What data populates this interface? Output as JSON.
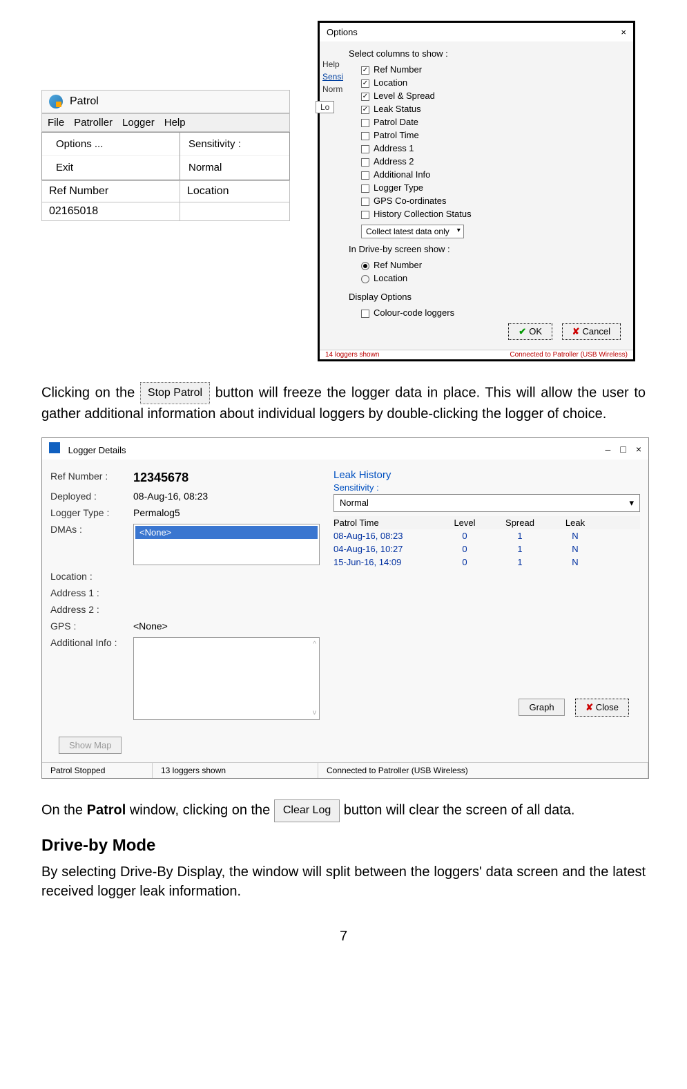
{
  "menu_panel": {
    "title": "Patrol",
    "menubar": [
      "File",
      "Patroller",
      "Logger",
      "Help"
    ],
    "open_items_left": [
      "Options ...",
      "Exit"
    ],
    "open_items_right": [
      "Sensitivity :",
      "Normal"
    ],
    "ref_header_left": "Ref Number",
    "ref_header_right": "Location",
    "ref_value": "02165018"
  },
  "options_dialog": {
    "title": "Options",
    "close_glyph": "×",
    "side_labels": [
      "Help",
      "Sensi",
      "Norm"
    ],
    "lo_box": "Lo",
    "section1": "Select columns to show :",
    "cols": [
      {
        "label": "Ref Number",
        "checked": true
      },
      {
        "label": "Location",
        "checked": true
      },
      {
        "label": "Level & Spread",
        "checked": true
      },
      {
        "label": "Leak Status",
        "checked": true
      },
      {
        "label": "Patrol Date",
        "checked": false
      },
      {
        "label": "Patrol Time",
        "checked": false
      },
      {
        "label": "Address 1",
        "checked": false
      },
      {
        "label": "Address 2",
        "checked": false
      },
      {
        "label": "Additional Info",
        "checked": false
      },
      {
        "label": "Logger Type",
        "checked": false
      },
      {
        "label": "GPS Co-ordinates",
        "checked": false
      },
      {
        "label": "History Collection Status",
        "checked": false
      }
    ],
    "collect_select": "Collect latest data only",
    "section2": "In Drive-by screen show :",
    "radios": [
      {
        "label": "Ref Number",
        "on": true
      },
      {
        "label": "Location",
        "on": false
      }
    ],
    "section3": "Display Options",
    "display_opt": {
      "label": "Colour-code loggers",
      "checked": false
    },
    "ok_label": "OK",
    "cancel_label": "Cancel",
    "status_left": "14 loggers shown",
    "status_right": "Connected to Patroller (USB Wireless)"
  },
  "para1_pre": "Clicking on the ",
  "stop_patrol_btn": "Stop Patrol",
  "para1_post": " button will freeze the logger data in place. This will allow the user to gather additional information about individual loggers by double-clicking the logger of choice.",
  "logger_details": {
    "title": "Logger Details",
    "win_controls": [
      "–",
      "□",
      "×"
    ],
    "left_rows": {
      "ref_label": "Ref Number :",
      "ref_value": "12345678",
      "dep_label": "Deployed :",
      "dep_value": "08-Aug-16, 08:23",
      "type_label": "Logger Type :",
      "type_value": "Permalog5",
      "dmas_label": "DMAs :",
      "dmas_value": "<None>",
      "loc_label": "Location :",
      "addr1_label": "Address 1 :",
      "addr2_label": "Address 2 :",
      "gps_label": "GPS :",
      "gps_value": "<None>",
      "addl_label": "Additional Info :"
    },
    "right": {
      "heading": "Leak History",
      "sens_label": "Sensitivity :",
      "sens_value": "Normal",
      "headers": {
        "pt": "Patrol Time",
        "lv": "Level",
        "sp": "Spread",
        "lk": "Leak"
      },
      "rows": [
        {
          "pt": "08-Aug-16, 08:23",
          "lv": "0",
          "sp": "1",
          "lk": "N"
        },
        {
          "pt": "04-Aug-16, 10:27",
          "lv": "0",
          "sp": "1",
          "lk": "N"
        },
        {
          "pt": "15-Jun-16, 14:09",
          "lv": "0",
          "sp": "1",
          "lk": "N"
        }
      ]
    },
    "show_map": "Show Map",
    "graph_btn": "Graph",
    "close_btn": "Close",
    "status": {
      "a": "Patrol Stopped",
      "b": "13 loggers shown",
      "c": "Connected to Patroller (USB Wireless)"
    }
  },
  "para2_pre": "On the ",
  "para2_bold": "Patrol",
  "para2_mid": " window, clicking on the ",
  "clear_log_btn": "Clear Log",
  "para2_post": " button will clear the screen of all data.",
  "heading_driveby": "Drive-by Mode",
  "para3": "By selecting Drive-By Display, the window will split between the loggers' data screen and the latest received logger leak information.",
  "page_number": "7"
}
